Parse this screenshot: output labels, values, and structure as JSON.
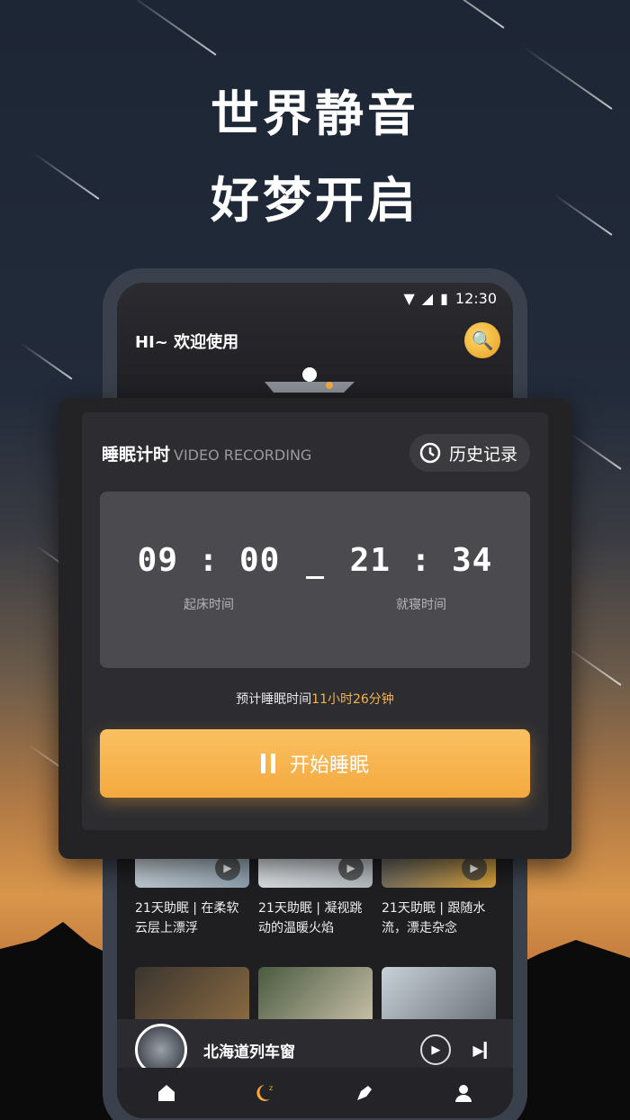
{
  "hero": {
    "line1": "世界静音",
    "line2": "好梦开启"
  },
  "status_bar": {
    "time": "12:30"
  },
  "app": {
    "greeting": "HI~ 欢迎使用"
  },
  "timer": {
    "title": "睡眠计时",
    "subtitle": "VIDEO RECORDING",
    "history_label": "历史记录",
    "wake_time": "09 : 00",
    "wake_label": "起床时间",
    "sleep_time": "21 : 34",
    "sleep_label": "就寝时间",
    "estimate_prefix": "预计睡眠时间",
    "estimate_value": "11小时26分钟",
    "start_label": "开始睡眠"
  },
  "cards": [
    {
      "title": "21天助眠 | 在柔软云层上漂浮"
    },
    {
      "title": "21天助眠 | 凝视跳动的温暖火焰"
    },
    {
      "title": "21天助眠 | 跟随水流，漂走杂念"
    }
  ],
  "player": {
    "title": "北海道列车窗"
  },
  "tabs": [
    "home-icon",
    "sleep-moon-icon",
    "pen-icon",
    "profile-icon"
  ],
  "colors": {
    "accent": "#f4a93f",
    "highlight": "#f4b34c",
    "card_bg": "#232326",
    "panel_bg": "#4b4b4f"
  }
}
